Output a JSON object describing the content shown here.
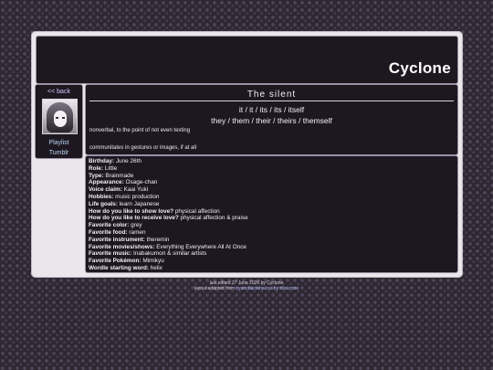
{
  "site_title": "Cyclone",
  "sidebar": {
    "back_label": "<< back",
    "links": [
      "Playlist",
      "Tumblr"
    ]
  },
  "character": {
    "name": "The silent",
    "pronouns_line1": "it / it / its / its / itself",
    "pronouns_line2": "they / them / their / theirs / themself",
    "description_line1": "nonverbal, to the point of not even texting",
    "description_line2": "communitates in gestures or images, if at all"
  },
  "details": [
    {
      "label": "Birthday:",
      "value": "June 26th"
    },
    {
      "label": "Role:",
      "value": "Little"
    },
    {
      "label": "Type:",
      "value": "Brainmade"
    },
    {
      "label": "Appearance:",
      "value": "Osage-chan"
    },
    {
      "label": "Voice claim:",
      "value": "Kaai Yuki"
    },
    {
      "label": "Hobbies:",
      "value": "music production"
    },
    {
      "label": "Life goals:",
      "value": "learn Japanese"
    },
    {
      "label": "How do you like to show love?",
      "value": "physical affection"
    },
    {
      "label": "How do you like to receive love?",
      "value": "physical affection & praise"
    },
    {
      "label": "Favorite color:",
      "value": "grey"
    },
    {
      "label": "Favorite food:",
      "value": "ramen"
    },
    {
      "label": "Favorite instrument:",
      "value": "theremin"
    },
    {
      "label": "Favorite movies/shows:",
      "value": "Everything Everywhere All At Once"
    },
    {
      "label": "Favorite music:",
      "value": "Inabakumori & similar artists"
    },
    {
      "label": "Favorite Pokémon:",
      "value": "Mimikyu"
    },
    {
      "label": "Wordle starting word:",
      "value": "helix"
    }
  ],
  "footer": {
    "line1": "last edited 27 June 2026 by Cyclone",
    "line2_prefix": "layout adapted from ",
    "line2_link": "cyanobacteria.css by ribo.zone"
  },
  "colors": {
    "background": "#2e2833",
    "frame": "#e9e6ec",
    "panel": "#1d1820",
    "link": "#b9d3ef"
  },
  "icons": {
    "avatar": "character-portrait"
  }
}
